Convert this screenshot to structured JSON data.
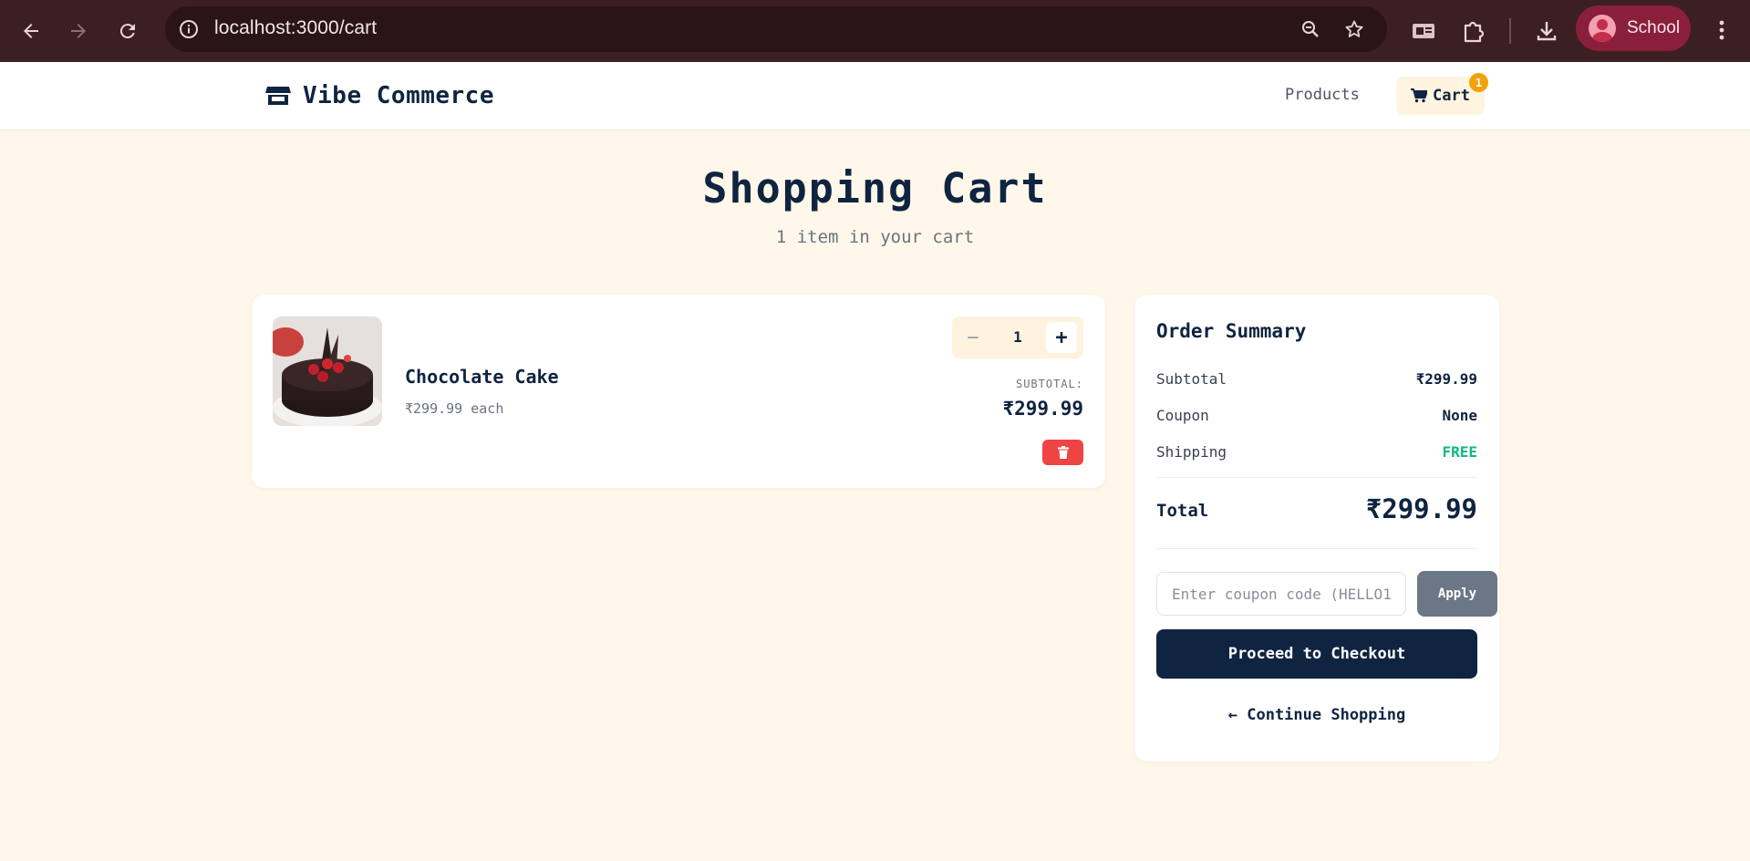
{
  "browser": {
    "url": "localhost:3000/cart",
    "profile_label": "School",
    "frame_color": "#3b1f23",
    "icons": [
      "back-arrow-icon",
      "forward-arrow-icon",
      "reload-icon",
      "info-icon",
      "zoom-icon",
      "star-icon",
      "media-card-icon",
      "extensions-icon",
      "download-icon",
      "avatar-icon",
      "more-vert-icon"
    ]
  },
  "header": {
    "brand": "Vibe Commerce",
    "nav_products": "Products",
    "cart_label": "Cart",
    "cart_badge": "1",
    "icons": [
      "store-icon",
      "cart-icon"
    ]
  },
  "page": {
    "title": "Shopping Cart",
    "subtitle": "1 item in your cart"
  },
  "cart": {
    "items": [
      {
        "name": "Chocolate Cake",
        "unit_price": "₹299.99 each",
        "quantity": "1",
        "minus_symbol": "−",
        "plus_symbol": "+",
        "subtotal_label": "SUBTOTAL:",
        "subtotal": "₹299.99",
        "image": "chocolate-cake-image",
        "delete_icon": "trash-icon"
      }
    ]
  },
  "summary": {
    "title": "Order Summary",
    "rows": [
      {
        "label": "Subtotal",
        "value": "₹299.99"
      },
      {
        "label": "Coupon",
        "value": "None"
      },
      {
        "label": "Shipping",
        "value": "FREE"
      }
    ],
    "total_label": "Total",
    "total_value": "₹299.99",
    "coupon_placeholder": "Enter coupon code (HELLO10)",
    "coupon_value": "",
    "apply_label": "Apply",
    "checkout_label": "Proceed to Checkout",
    "continue_label": "← Continue Shopping"
  },
  "colors": {
    "background": "#fff8ea",
    "navy": "#0f2440",
    "badge": "#f5a10c",
    "danger": "#ef4444",
    "free": "#10b981",
    "apply_button": "#6b7686"
  }
}
